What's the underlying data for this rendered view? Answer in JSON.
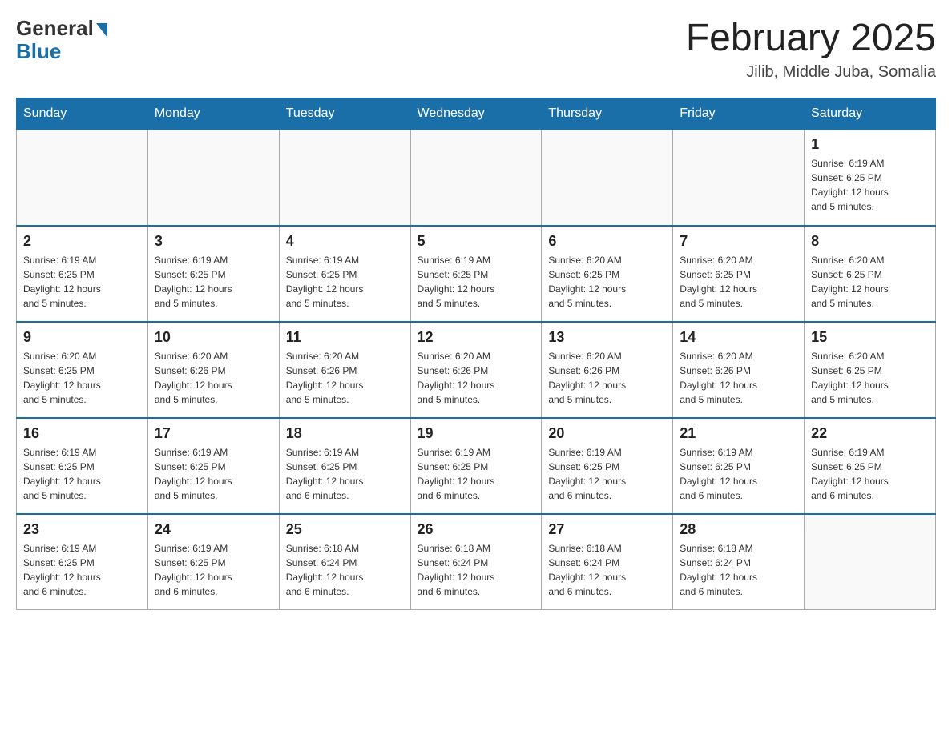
{
  "header": {
    "logo_general": "General",
    "logo_blue": "Blue",
    "month_title": "February 2025",
    "location": "Jilib, Middle Juba, Somalia"
  },
  "days_of_week": [
    "Sunday",
    "Monday",
    "Tuesday",
    "Wednesday",
    "Thursday",
    "Friday",
    "Saturday"
  ],
  "weeks": [
    [
      {
        "day": "",
        "info": ""
      },
      {
        "day": "",
        "info": ""
      },
      {
        "day": "",
        "info": ""
      },
      {
        "day": "",
        "info": ""
      },
      {
        "day": "",
        "info": ""
      },
      {
        "day": "",
        "info": ""
      },
      {
        "day": "1",
        "info": "Sunrise: 6:19 AM\nSunset: 6:25 PM\nDaylight: 12 hours\nand 5 minutes."
      }
    ],
    [
      {
        "day": "2",
        "info": "Sunrise: 6:19 AM\nSunset: 6:25 PM\nDaylight: 12 hours\nand 5 minutes."
      },
      {
        "day": "3",
        "info": "Sunrise: 6:19 AM\nSunset: 6:25 PM\nDaylight: 12 hours\nand 5 minutes."
      },
      {
        "day": "4",
        "info": "Sunrise: 6:19 AM\nSunset: 6:25 PM\nDaylight: 12 hours\nand 5 minutes."
      },
      {
        "day": "5",
        "info": "Sunrise: 6:19 AM\nSunset: 6:25 PM\nDaylight: 12 hours\nand 5 minutes."
      },
      {
        "day": "6",
        "info": "Sunrise: 6:20 AM\nSunset: 6:25 PM\nDaylight: 12 hours\nand 5 minutes."
      },
      {
        "day": "7",
        "info": "Sunrise: 6:20 AM\nSunset: 6:25 PM\nDaylight: 12 hours\nand 5 minutes."
      },
      {
        "day": "8",
        "info": "Sunrise: 6:20 AM\nSunset: 6:25 PM\nDaylight: 12 hours\nand 5 minutes."
      }
    ],
    [
      {
        "day": "9",
        "info": "Sunrise: 6:20 AM\nSunset: 6:25 PM\nDaylight: 12 hours\nand 5 minutes."
      },
      {
        "day": "10",
        "info": "Sunrise: 6:20 AM\nSunset: 6:26 PM\nDaylight: 12 hours\nand 5 minutes."
      },
      {
        "day": "11",
        "info": "Sunrise: 6:20 AM\nSunset: 6:26 PM\nDaylight: 12 hours\nand 5 minutes."
      },
      {
        "day": "12",
        "info": "Sunrise: 6:20 AM\nSunset: 6:26 PM\nDaylight: 12 hours\nand 5 minutes."
      },
      {
        "day": "13",
        "info": "Sunrise: 6:20 AM\nSunset: 6:26 PM\nDaylight: 12 hours\nand 5 minutes."
      },
      {
        "day": "14",
        "info": "Sunrise: 6:20 AM\nSunset: 6:26 PM\nDaylight: 12 hours\nand 5 minutes."
      },
      {
        "day": "15",
        "info": "Sunrise: 6:20 AM\nSunset: 6:25 PM\nDaylight: 12 hours\nand 5 minutes."
      }
    ],
    [
      {
        "day": "16",
        "info": "Sunrise: 6:19 AM\nSunset: 6:25 PM\nDaylight: 12 hours\nand 5 minutes."
      },
      {
        "day": "17",
        "info": "Sunrise: 6:19 AM\nSunset: 6:25 PM\nDaylight: 12 hours\nand 5 minutes."
      },
      {
        "day": "18",
        "info": "Sunrise: 6:19 AM\nSunset: 6:25 PM\nDaylight: 12 hours\nand 6 minutes."
      },
      {
        "day": "19",
        "info": "Sunrise: 6:19 AM\nSunset: 6:25 PM\nDaylight: 12 hours\nand 6 minutes."
      },
      {
        "day": "20",
        "info": "Sunrise: 6:19 AM\nSunset: 6:25 PM\nDaylight: 12 hours\nand 6 minutes."
      },
      {
        "day": "21",
        "info": "Sunrise: 6:19 AM\nSunset: 6:25 PM\nDaylight: 12 hours\nand 6 minutes."
      },
      {
        "day": "22",
        "info": "Sunrise: 6:19 AM\nSunset: 6:25 PM\nDaylight: 12 hours\nand 6 minutes."
      }
    ],
    [
      {
        "day": "23",
        "info": "Sunrise: 6:19 AM\nSunset: 6:25 PM\nDaylight: 12 hours\nand 6 minutes."
      },
      {
        "day": "24",
        "info": "Sunrise: 6:19 AM\nSunset: 6:25 PM\nDaylight: 12 hours\nand 6 minutes."
      },
      {
        "day": "25",
        "info": "Sunrise: 6:18 AM\nSunset: 6:24 PM\nDaylight: 12 hours\nand 6 minutes."
      },
      {
        "day": "26",
        "info": "Sunrise: 6:18 AM\nSunset: 6:24 PM\nDaylight: 12 hours\nand 6 minutes."
      },
      {
        "day": "27",
        "info": "Sunrise: 6:18 AM\nSunset: 6:24 PM\nDaylight: 12 hours\nand 6 minutes."
      },
      {
        "day": "28",
        "info": "Sunrise: 6:18 AM\nSunset: 6:24 PM\nDaylight: 12 hours\nand 6 minutes."
      },
      {
        "day": "",
        "info": ""
      }
    ]
  ]
}
